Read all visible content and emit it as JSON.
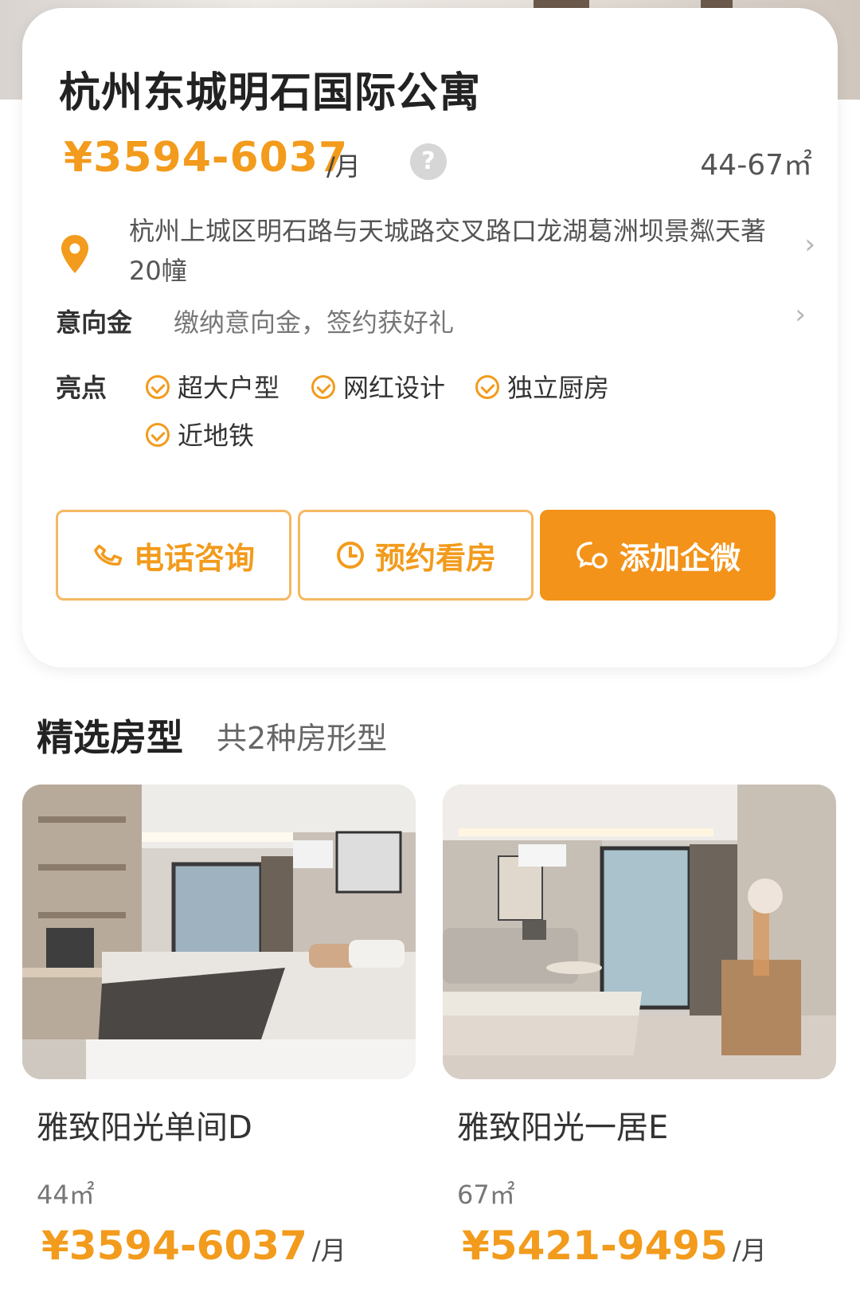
{
  "apartment": {
    "title": "杭州东城明石国际公寓",
    "price": "¥3594-6037",
    "price_unit": "/月",
    "help_label": "?",
    "area": "44-67㎡",
    "address": "杭州上城区明石路与天城路交叉路口龙湖葛洲坝景粼天著20幢"
  },
  "intent": {
    "label": "意向金",
    "text": "缴纳意向金，签约获好礼"
  },
  "highlights": {
    "label": "亮点",
    "tags": [
      "超大户型",
      "网红设计",
      "独立厨房",
      "近地铁"
    ]
  },
  "actions": {
    "phone": "电话咨询",
    "appointment": "预约看房",
    "wecom": "添加企微"
  },
  "room_section": {
    "title": "精选房型",
    "subtitle": "共2种房形型"
  },
  "rooms": [
    {
      "name": "雅致阳光单间D",
      "area": "44㎡",
      "price": "¥3594-6037",
      "unit": "/月"
    },
    {
      "name": "雅致阳光一居E",
      "area": "67㎡",
      "price": "¥5421-9495",
      "unit": "/月"
    }
  ],
  "colors": {
    "accent": "#f29b1c",
    "button_solid": "#f39319",
    "button_border": "#f5b862"
  },
  "icons": {
    "location": "location-pin-icon",
    "phone": "phone-icon",
    "clock": "clock-icon",
    "chat": "wecom-chat-icon",
    "check": "check-circle-icon",
    "chevron": "chevron-right-icon"
  }
}
